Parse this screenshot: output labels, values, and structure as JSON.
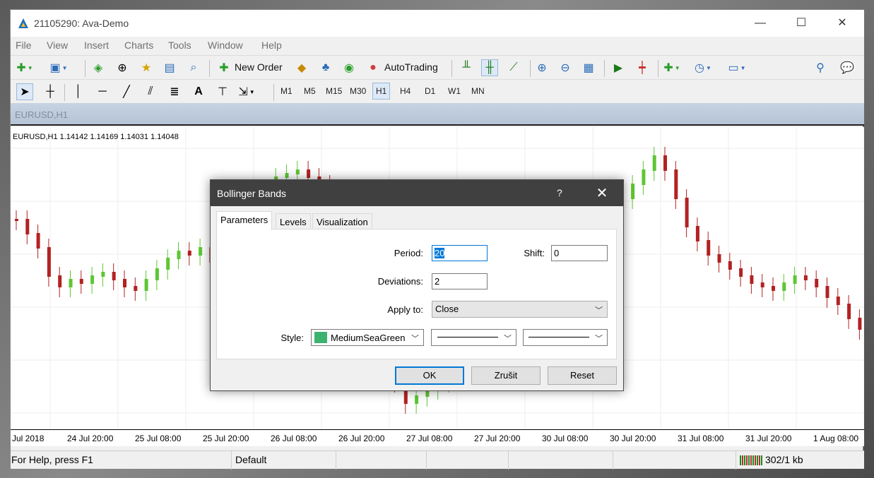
{
  "window": {
    "title": "21105290: Ava-Demo",
    "minimize": "—",
    "maximize": "☐",
    "close": "✕"
  },
  "menu": [
    "File",
    "View",
    "Insert",
    "Charts",
    "Tools",
    "Window",
    "Help"
  ],
  "toolbar": {
    "new_order": "New Order",
    "autotrading": "AutoTrading"
  },
  "timeframes": [
    "M1",
    "M5",
    "M15",
    "M30",
    "H1",
    "H4",
    "D1",
    "W1",
    "MN"
  ],
  "active_timeframe": "H1",
  "chart": {
    "tab": "EURUSD,H1",
    "ohlc_label": "EURUSD,H1  1.14142 1.14169 1.14031 1.14048",
    "bull_color": "#5ec634",
    "bear_color": "#b22222"
  },
  "time_axis": [
    "Jul 2018",
    "24 Jul 20:00",
    "25 Jul 08:00",
    "25 Jul 20:00",
    "26 Jul 08:00",
    "26 Jul 20:00",
    "27 Jul 08:00",
    "27 Jul 20:00",
    "30 Jul 08:00",
    "30 Jul 20:00",
    "31 Jul 08:00",
    "31 Jul 20:00",
    "1 Aug 08:00"
  ],
  "status": {
    "help": "For Help, press F1",
    "profile": "Default",
    "traffic": "302/1 kb"
  },
  "dialog": {
    "title": "Bollinger Bands",
    "help": "?",
    "close": "✕",
    "tabs": [
      "Parameters",
      "Levels",
      "Visualization"
    ],
    "period_label": "Period:",
    "period": "20",
    "shift_label": "Shift:",
    "shift": "0",
    "deviations_label": "Deviations:",
    "deviations": "2",
    "apply_label": "Apply to:",
    "apply": "Close",
    "style_label": "Style:",
    "color_name": "MediumSeaGreen",
    "color": "#3cb371",
    "ok": "OK",
    "cancel": "Zrušit",
    "reset": "Reset"
  }
}
